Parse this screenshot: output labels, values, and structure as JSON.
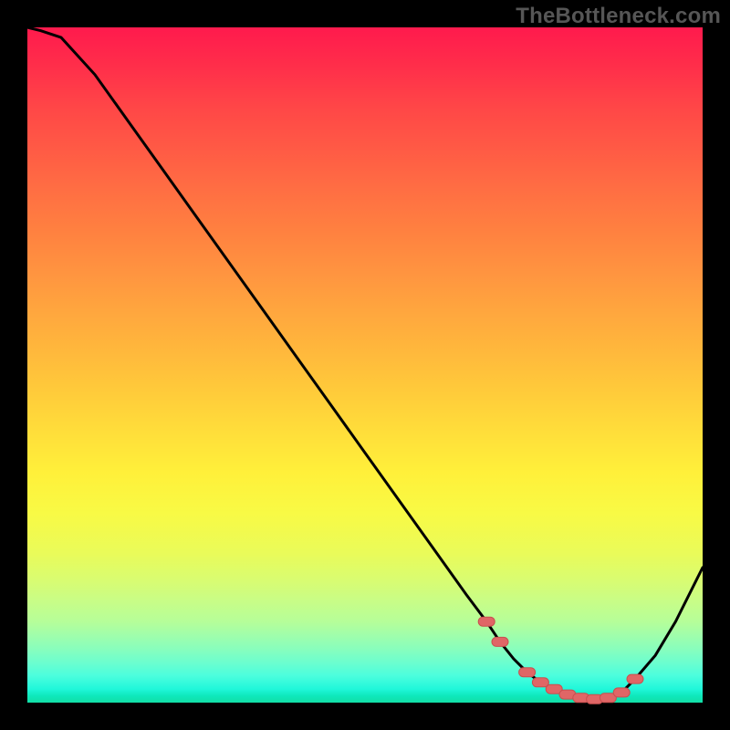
{
  "watermark": "TheBottleneck.com",
  "colors": {
    "curve_stroke": "#000000",
    "marker_fill": "#e06666",
    "marker_stroke": "#c94f4f",
    "frame": "#000000"
  },
  "chart_data": {
    "type": "line",
    "title": "",
    "xlabel": "",
    "ylabel": "",
    "xlim": [
      0,
      100
    ],
    "ylim": [
      0,
      100
    ],
    "x": [
      0,
      2,
      5,
      10,
      15,
      20,
      25,
      30,
      35,
      40,
      45,
      50,
      55,
      60,
      65,
      68,
      70,
      72,
      74,
      76,
      78,
      80,
      82,
      84,
      86,
      88,
      90,
      93,
      96,
      100
    ],
    "y": [
      100,
      99.5,
      98.5,
      93,
      86,
      79,
      72,
      65,
      58,
      51,
      44,
      37,
      30,
      23,
      16,
      12,
      9,
      6.5,
      4.5,
      3,
      2,
      1.2,
      0.7,
      0.5,
      0.7,
      1.5,
      3.5,
      7,
      12,
      20
    ],
    "markers": {
      "x": [
        68,
        70,
        74,
        76,
        78,
        80,
        82,
        84,
        86,
        88,
        90
      ],
      "y": [
        12,
        9,
        4.5,
        3,
        2,
        1.2,
        0.7,
        0.5,
        0.7,
        1.5,
        3.5
      ]
    }
  }
}
